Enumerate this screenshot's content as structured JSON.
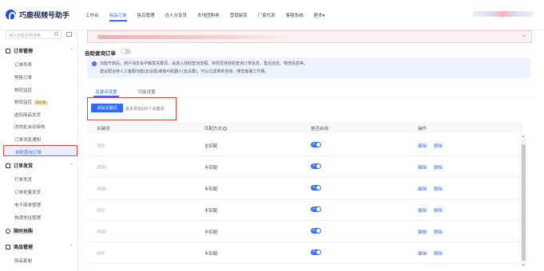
{
  "app": {
    "title": "巧鹿视频号助手"
  },
  "nav": {
    "items": [
      "工作台",
      "商品订单",
      "售后管理",
      "达人分享员",
      "本地团购券",
      "营销裂变",
      "厂家代发",
      "客服系统",
      "更多"
    ],
    "active": "商品订单",
    "more_arrow": "▾"
  },
  "sidebar": {
    "search_placeholder": "输入功能名称搜索",
    "groups": [
      {
        "label": "订单管理",
        "items": [
          "订单列表",
          "预售订单",
          "物流监控",
          "物流监控",
          "虚拟商品发货",
          "改地址自动审核",
          "订单消息通知",
          "自助查询订单"
        ],
        "new_tag": "高阶版"
      },
      {
        "label": "订单发货",
        "items": [
          "打单发货",
          "订单批量发货",
          "电子面单管理",
          "快递地址管理"
        ]
      },
      {
        "label": "限时抢购",
        "items": []
      },
      {
        "label": "商品管理",
        "items": [
          "商品复制"
        ]
      }
    ],
    "chevron_up": "⌃",
    "chevron_down": "⌄"
  },
  "main": {
    "alert_close": "×",
    "title": "自助查询订单",
    "info": {
      "icon": "i",
      "line1": "功能开启后，用户消息会中触发关键词，会进入自助查询流程。目前支持自助查询订单信息、售后信息、物流信息等。",
      "line2": "建议配合转人工客服功能(去设置)或者AI机器人(去设置)，可以过滤简单咨询，降低客服工作量。"
    },
    "tabs": [
      "关键词设置",
      "功能设置"
    ],
    "add_button": "添加关键词",
    "add_hint": "最多添加100个关键词",
    "table": {
      "headers": {
        "keyword": "关键词",
        "match": "匹配方式",
        "enabled": "是否启用",
        "actions": "操作"
      },
      "help_icon": "?",
      "rows": [
        {
          "match": "全匹配",
          "enabled": true
        },
        {
          "match": "半匹配",
          "enabled": true
        },
        {
          "match": "半匹配",
          "enabled": true
        },
        {
          "match": "半匹配",
          "enabled": true
        },
        {
          "match": "半匹配",
          "enabled": true
        },
        {
          "match": "半匹配",
          "enabled": true
        }
      ],
      "on_label": "开",
      "edit_label": "编辑",
      "delete_label": "删除"
    },
    "scroll_up": "▲",
    "scroll_down": "▼"
  },
  "colors": {
    "primary": "#2f6bff",
    "highlight_border": "#d84a3c",
    "alert_bg": "#fdf1f1",
    "info_bg": "#edf3ff"
  }
}
